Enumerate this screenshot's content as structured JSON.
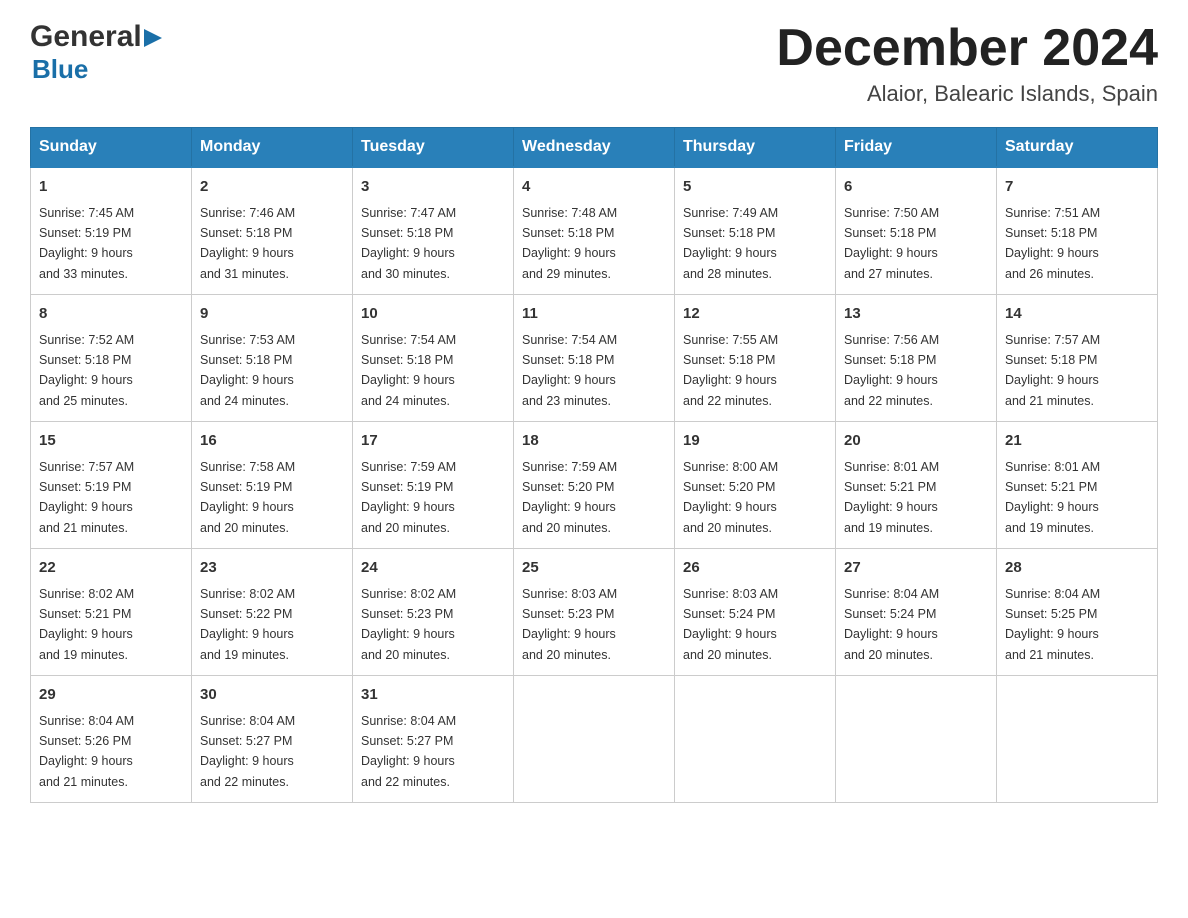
{
  "logo": {
    "general_text": "General",
    "blue_text": "Blue"
  },
  "title": "December 2024",
  "location": "Alaior, Balearic Islands, Spain",
  "days_of_week": [
    "Sunday",
    "Monday",
    "Tuesday",
    "Wednesday",
    "Thursday",
    "Friday",
    "Saturday"
  ],
  "weeks": [
    [
      {
        "day": "1",
        "sunrise": "7:45 AM",
        "sunset": "5:19 PM",
        "daylight": "9 hours and 33 minutes."
      },
      {
        "day": "2",
        "sunrise": "7:46 AM",
        "sunset": "5:18 PM",
        "daylight": "9 hours and 31 minutes."
      },
      {
        "day": "3",
        "sunrise": "7:47 AM",
        "sunset": "5:18 PM",
        "daylight": "9 hours and 30 minutes."
      },
      {
        "day": "4",
        "sunrise": "7:48 AM",
        "sunset": "5:18 PM",
        "daylight": "9 hours and 29 minutes."
      },
      {
        "day": "5",
        "sunrise": "7:49 AM",
        "sunset": "5:18 PM",
        "daylight": "9 hours and 28 minutes."
      },
      {
        "day": "6",
        "sunrise": "7:50 AM",
        "sunset": "5:18 PM",
        "daylight": "9 hours and 27 minutes."
      },
      {
        "day": "7",
        "sunrise": "7:51 AM",
        "sunset": "5:18 PM",
        "daylight": "9 hours and 26 minutes."
      }
    ],
    [
      {
        "day": "8",
        "sunrise": "7:52 AM",
        "sunset": "5:18 PM",
        "daylight": "9 hours and 25 minutes."
      },
      {
        "day": "9",
        "sunrise": "7:53 AM",
        "sunset": "5:18 PM",
        "daylight": "9 hours and 24 minutes."
      },
      {
        "day": "10",
        "sunrise": "7:54 AM",
        "sunset": "5:18 PM",
        "daylight": "9 hours and 24 minutes."
      },
      {
        "day": "11",
        "sunrise": "7:54 AM",
        "sunset": "5:18 PM",
        "daylight": "9 hours and 23 minutes."
      },
      {
        "day": "12",
        "sunrise": "7:55 AM",
        "sunset": "5:18 PM",
        "daylight": "9 hours and 22 minutes."
      },
      {
        "day": "13",
        "sunrise": "7:56 AM",
        "sunset": "5:18 PM",
        "daylight": "9 hours and 22 minutes."
      },
      {
        "day": "14",
        "sunrise": "7:57 AM",
        "sunset": "5:18 PM",
        "daylight": "9 hours and 21 minutes."
      }
    ],
    [
      {
        "day": "15",
        "sunrise": "7:57 AM",
        "sunset": "5:19 PM",
        "daylight": "9 hours and 21 minutes."
      },
      {
        "day": "16",
        "sunrise": "7:58 AM",
        "sunset": "5:19 PM",
        "daylight": "9 hours and 20 minutes."
      },
      {
        "day": "17",
        "sunrise": "7:59 AM",
        "sunset": "5:19 PM",
        "daylight": "9 hours and 20 minutes."
      },
      {
        "day": "18",
        "sunrise": "7:59 AM",
        "sunset": "5:20 PM",
        "daylight": "9 hours and 20 minutes."
      },
      {
        "day": "19",
        "sunrise": "8:00 AM",
        "sunset": "5:20 PM",
        "daylight": "9 hours and 20 minutes."
      },
      {
        "day": "20",
        "sunrise": "8:01 AM",
        "sunset": "5:21 PM",
        "daylight": "9 hours and 19 minutes."
      },
      {
        "day": "21",
        "sunrise": "8:01 AM",
        "sunset": "5:21 PM",
        "daylight": "9 hours and 19 minutes."
      }
    ],
    [
      {
        "day": "22",
        "sunrise": "8:02 AM",
        "sunset": "5:21 PM",
        "daylight": "9 hours and 19 minutes."
      },
      {
        "day": "23",
        "sunrise": "8:02 AM",
        "sunset": "5:22 PM",
        "daylight": "9 hours and 19 minutes."
      },
      {
        "day": "24",
        "sunrise": "8:02 AM",
        "sunset": "5:23 PM",
        "daylight": "9 hours and 20 minutes."
      },
      {
        "day": "25",
        "sunrise": "8:03 AM",
        "sunset": "5:23 PM",
        "daylight": "9 hours and 20 minutes."
      },
      {
        "day": "26",
        "sunrise": "8:03 AM",
        "sunset": "5:24 PM",
        "daylight": "9 hours and 20 minutes."
      },
      {
        "day": "27",
        "sunrise": "8:04 AM",
        "sunset": "5:24 PM",
        "daylight": "9 hours and 20 minutes."
      },
      {
        "day": "28",
        "sunrise": "8:04 AM",
        "sunset": "5:25 PM",
        "daylight": "9 hours and 21 minutes."
      }
    ],
    [
      {
        "day": "29",
        "sunrise": "8:04 AM",
        "sunset": "5:26 PM",
        "daylight": "9 hours and 21 minutes."
      },
      {
        "day": "30",
        "sunrise": "8:04 AM",
        "sunset": "5:27 PM",
        "daylight": "9 hours and 22 minutes."
      },
      {
        "day": "31",
        "sunrise": "8:04 AM",
        "sunset": "5:27 PM",
        "daylight": "9 hours and 22 minutes."
      },
      null,
      null,
      null,
      null
    ]
  ],
  "labels": {
    "sunrise": "Sunrise:",
    "sunset": "Sunset:",
    "daylight": "Daylight:"
  }
}
